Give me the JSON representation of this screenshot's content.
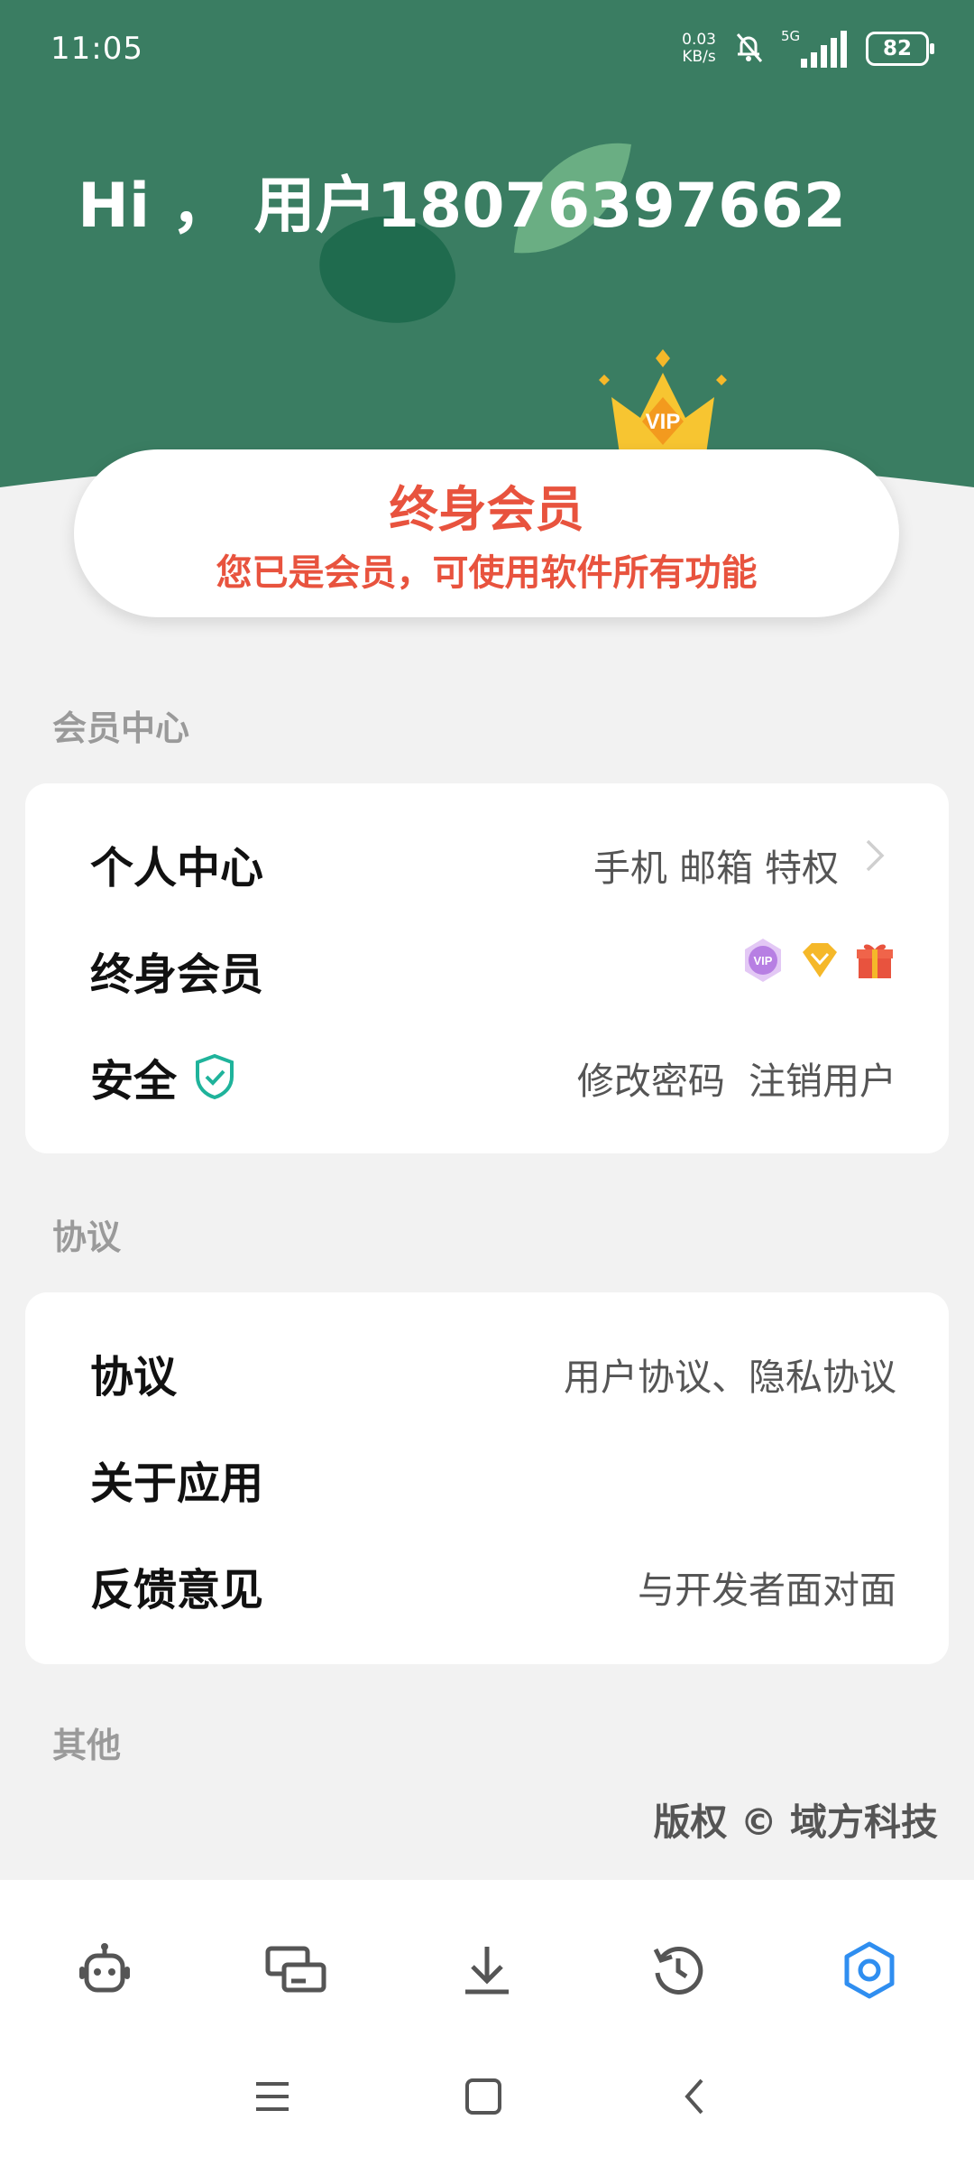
{
  "colors": {
    "header_green": "#3a7d62",
    "vip_red": "#e8533e",
    "shield_teal": "#1fb39b",
    "active_blue": "#2f8ef0"
  },
  "status_bar": {
    "time": "11:05",
    "net_speed_value": "0.03",
    "net_speed_unit": "KB/s",
    "network": "5G",
    "battery": "82"
  },
  "header": {
    "greeting": "Hi ， 用户18076397662"
  },
  "vip_card": {
    "badge_text": "VIP",
    "title": "终身会员",
    "subtitle": "您已是会员，可使用软件所有功能"
  },
  "sections": {
    "member_center": {
      "label": "会员中心",
      "rows": [
        {
          "title": "个人中心",
          "detail": "手机 邮箱 特权",
          "icon": "chevron-right-icon"
        },
        {
          "title": "终身会员",
          "badges": [
            "vip-badge-icon",
            "diamond-icon",
            "gift-icon"
          ],
          "vip_badge_text": "VIP"
        },
        {
          "title": "安全",
          "title_icon": "shield-check-icon",
          "detail": "修改密码  注销用户"
        }
      ]
    },
    "agreement": {
      "label": "协议",
      "rows": [
        {
          "title": "协议",
          "detail": "用户协议、隐私协议"
        },
        {
          "title": "关于应用",
          "detail": ""
        },
        {
          "title": "反馈意见",
          "detail": "与开发者面对面"
        }
      ]
    },
    "other": {
      "label": "其他"
    }
  },
  "copyright": "版权 © 域方科技",
  "bottom_nav": {
    "items": [
      "robot-icon",
      "devices-icon",
      "download-icon",
      "history-icon",
      "settings-icon"
    ],
    "active": "settings-icon"
  },
  "system_nav": [
    "menu-icon",
    "home-icon",
    "back-icon"
  ]
}
